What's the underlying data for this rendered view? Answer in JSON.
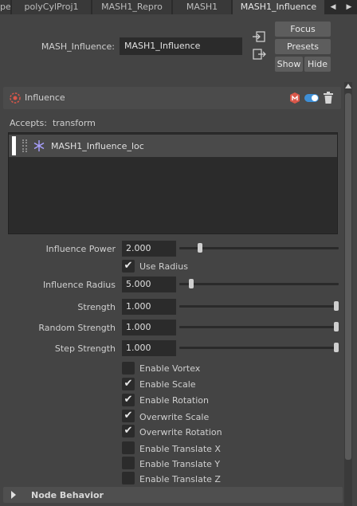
{
  "tabs": [
    {
      "label": "pe",
      "active": false
    },
    {
      "label": "polyCylProj1",
      "active": false
    },
    {
      "label": "MASH1_Repro",
      "active": false
    },
    {
      "label": "MASH1",
      "active": false
    },
    {
      "label": "MASH1_Influence",
      "active": true
    }
  ],
  "header": {
    "node_type_label": "MASH_Influence:",
    "node_name_value": "MASH1_Influence",
    "focus_label": "Focus",
    "presets_label": "Presets",
    "show_label": "Show",
    "hide_label": "Hide"
  },
  "section": {
    "title": "Influence",
    "accepts_label": "Accepts:",
    "accepts_value": "transform",
    "list_items": [
      {
        "name": "MASH1_Influence_loc",
        "icon": "locator-icon"
      }
    ]
  },
  "attributes": {
    "influence_power": {
      "label": "Influence Power",
      "value": "2.000",
      "slider": 0.12
    },
    "use_radius": {
      "label": "Use Radius",
      "checked": true
    },
    "influence_radius": {
      "label": "Influence Radius",
      "value": "5.000",
      "slider": 0.06
    },
    "strength": {
      "label": "Strength",
      "value": "1.000",
      "slider": 1.0
    },
    "random_strength": {
      "label": "Random Strength",
      "value": "1.000",
      "slider": 1.0
    },
    "step_strength": {
      "label": "Step Strength",
      "value": "1.000",
      "slider": 1.0
    }
  },
  "checkboxes": [
    {
      "label": "Enable Vortex",
      "checked": false
    },
    {
      "label": "Enable Scale",
      "checked": true
    },
    {
      "label": "Enable Rotation",
      "checked": true
    },
    {
      "label": "Overwrite Scale",
      "checked": true
    },
    {
      "label": "Overwrite Rotation",
      "checked": true
    },
    {
      "label": "Enable Translate X",
      "checked": false
    },
    {
      "label": "Enable Translate Y",
      "checked": false
    },
    {
      "label": "Enable Translate Z",
      "checked": false
    }
  ],
  "bottom_section": {
    "title": "Node Behavior"
  },
  "colors": {
    "accent_red": "#d9574a",
    "toggle_blue": "#3e8fd6",
    "panel_bg": "#444444",
    "field_bg": "#2b2b2b"
  }
}
